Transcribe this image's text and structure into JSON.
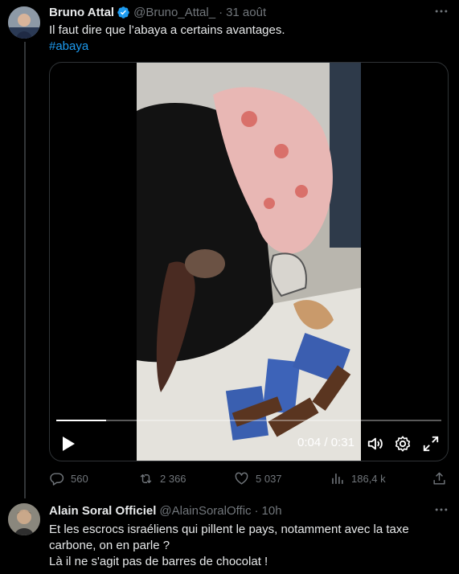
{
  "tweet": {
    "author_name": "Bruno Attal",
    "author_handle": "@Bruno_Attal_",
    "separator": "·",
    "time": "31 août",
    "text": "Il faut dire que l’abaya a certains avantages.",
    "hashtag": "#abaya",
    "video": {
      "current_time": "0:04",
      "time_separator": "/",
      "duration": "0:31",
      "progress": 0.13
    },
    "stats": {
      "replies": "560",
      "reposts": "2 366",
      "likes": "5 037",
      "views": "186,4 k"
    }
  },
  "reply": {
    "author_name": "Alain Soral Officiel",
    "author_handle": "@AlainSoralOffic",
    "separator": "·",
    "time": "10h",
    "text": "Et les escrocs israéliens qui pillent le pays, notamment avec la taxe carbone, on en parle ?\nLà il ne s'agit pas de barres de chocolat !"
  },
  "colors": {
    "background": "#000000",
    "text": "#e7e9ea",
    "muted": "#71767b",
    "accent": "#1d9bf0",
    "border": "#2f3336"
  },
  "icons": [
    "verified-badge-icon",
    "more-icon",
    "play-icon",
    "volume-icon",
    "settings-icon",
    "fullscreen-icon",
    "reply-icon",
    "repost-icon",
    "like-icon",
    "views-icon",
    "share-icon"
  ]
}
